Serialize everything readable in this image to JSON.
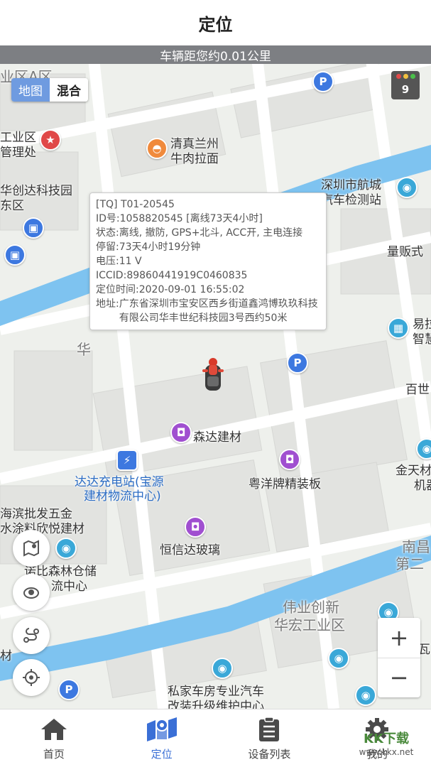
{
  "header": {
    "title": "定位"
  },
  "distance_bar": {
    "text": "车辆距您约0.01公里"
  },
  "map_toggle": {
    "map_label": "地图",
    "mixed_label": "混合"
  },
  "traffic": {
    "count": "9"
  },
  "map_labels": {
    "industrial_zone_a": "业区A区",
    "industrial_admin_1": "工业区",
    "industrial_admin_2": "管理处",
    "qingzhen_1": "清真兰州",
    "qingzhen_2": "牛肉拉面",
    "chuangda_1": "华创达科技园",
    "chuangda_2": "东区",
    "hangcheng_1": "深圳市航城",
    "hangcheng_2": "汽车检测站",
    "mart": "量贩式",
    "yida_1": "易拉",
    "yida_2": "智慧",
    "baishi": "百世",
    "senda": "森达建材",
    "dada_1": "达达充电站(宝源",
    "dada_2": "建材物流中心)",
    "yueyang": "粤洋牌精装板",
    "jintian_1": "金天材",
    "jintian_2": "机器",
    "haibin_1": "海滨批发五金",
    "haibin_2": "水涂料欣悦建材",
    "hengxinda": "恒信达玻璃",
    "nuobi_1": "诺比森林仓储",
    "nuobi_2": "流中心",
    "nanchang_1": "南昌",
    "nanchang_2": "第二",
    "weiye_1": "伟业创新",
    "weiye_2": "华宏工业区",
    "cai": "材",
    "zhiji": "志记瓦",
    "private_1": "私家车房专业汽车",
    "private_2": "改装升级维护中心",
    "hua": "华"
  },
  "popup": {
    "line_device": "[TQ] T01-20545",
    "id_key": "ID号:",
    "id_val": "1058820545 [离线73天4小时]",
    "status_key": "状态:",
    "status_val": "离线, 撤防, GPS+北斗, ACC开, 主电连接",
    "stay_key": "停留:",
    "stay_val": "73天4小时19分钟",
    "volt_key": "电压:",
    "volt_val": "11 V",
    "iccid_key": "ICCID:",
    "iccid_val": "89860441919C0460835",
    "time_key": "定位时间:",
    "time_val": "2020-09-01 16:55:02",
    "addr_key": "地址:",
    "addr_val": "广东省深圳市宝安区西乡街道鑫鸿博玖玖科技有限公司华丰世纪科技园3号西约50米"
  },
  "zoom": {
    "in": "+",
    "out": "−"
  },
  "tabs": [
    {
      "label": "首页",
      "icon": "home-icon"
    },
    {
      "label": "定位",
      "icon": "map-location-icon"
    },
    {
      "label": "设备列表",
      "icon": "clipboard-list-icon"
    },
    {
      "label": "我的",
      "icon": "gear-icon"
    }
  ],
  "watermark": {
    "main": "KK下载",
    "sub": "www.kkx.net"
  },
  "colors": {
    "accent": "#3a6fd6",
    "river": "#7ec3f0",
    "road": "#ffffff",
    "block": "#e2e3e0"
  }
}
